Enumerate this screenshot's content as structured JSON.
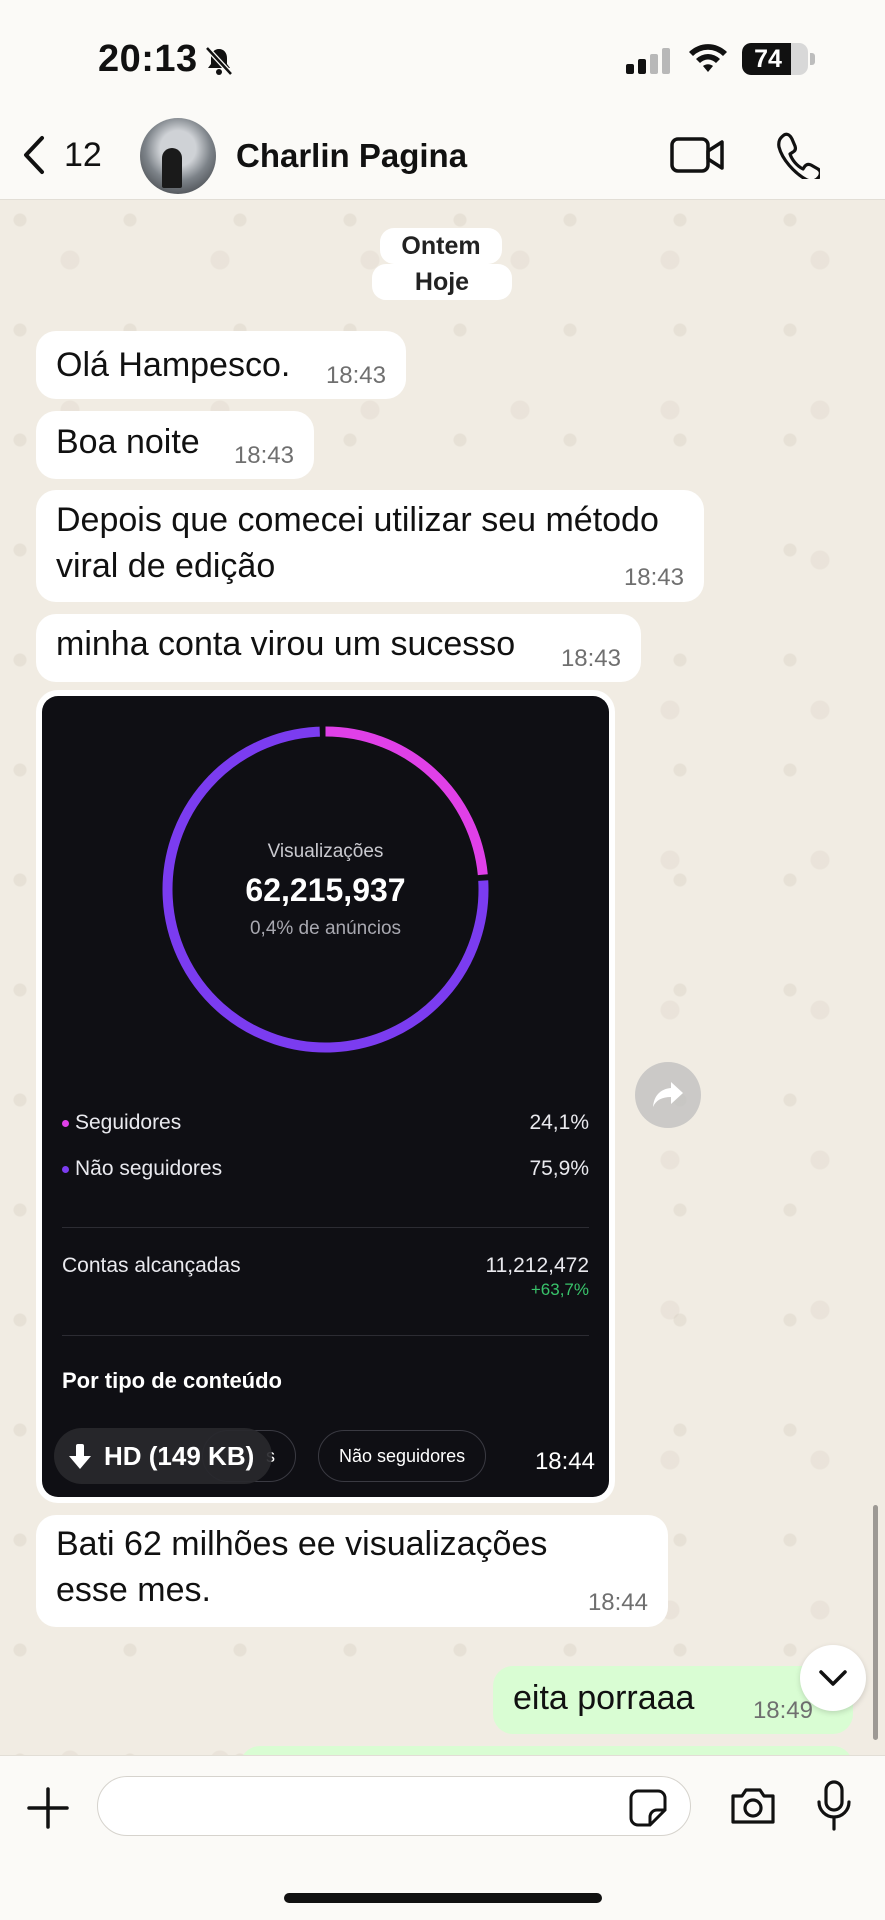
{
  "status_bar": {
    "time": "20:13",
    "battery": "74",
    "battery_level": 0.74
  },
  "header": {
    "back_count": "12",
    "contact_name": "Charlin Pagina"
  },
  "chat": {
    "date_labels": [
      "Ontem",
      "Hoje"
    ],
    "messages": [
      {
        "text": "Olá Hampesco.",
        "time": "18:43"
      },
      {
        "text": "Boa noite",
        "time": "18:43"
      },
      {
        "text": "Depois que comecei utilizar seu método viral de edição",
        "time": "18:43"
      },
      {
        "text": "minha conta virou um sucesso",
        "time": "18:43"
      },
      {
        "text": "Bati 62 milhões ee visualizações esse mes.",
        "time": "18:44"
      }
    ],
    "media": {
      "views_label": "Visualizações",
      "views_value": "62,215,937",
      "ads_share": "0,4% de anúncios",
      "followers_label": "Seguidores",
      "followers_pct": "24,1%",
      "followers_fraction": 0.241,
      "non_followers_label": "Não seguidores",
      "non_followers_pct": "75,9%",
      "reach_label": "Contas alcançadas",
      "reach_value": "11,212,472",
      "reach_change": "+63,7%",
      "content_type_title": "Por tipo de conteúdo",
      "chip_partial": "s",
      "chip_non_followers": "Não seguidores",
      "hd_label": "HD (149 KB)",
      "time": "18:44",
      "colors": {
        "followers": "#e040e8",
        "non_followers": "#7b3cf0"
      }
    },
    "outgoing": {
      "text": "eita porraaa",
      "time": "18:49"
    }
  },
  "input": {
    "placeholder": ""
  }
}
